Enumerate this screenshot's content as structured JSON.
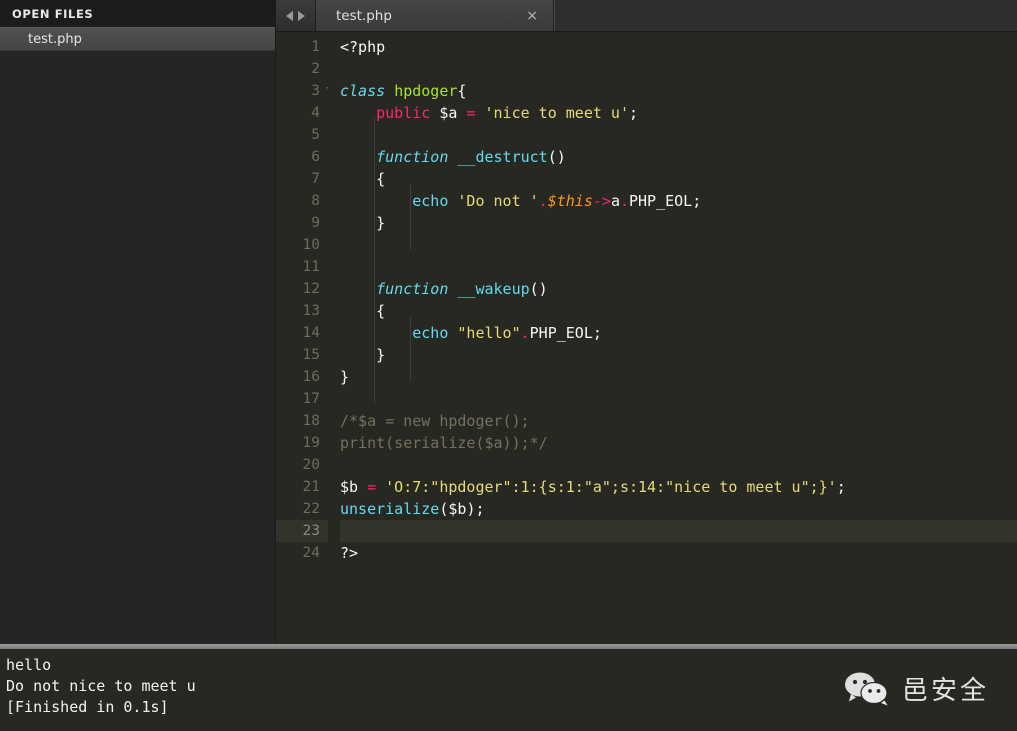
{
  "sidebar": {
    "header": "OPEN FILES",
    "files": [
      {
        "name": "test.php"
      }
    ]
  },
  "tabbar": {
    "nav_back_icon": "arrow-left-icon",
    "nav_forward_icon": "arrow-right-icon",
    "tabs": [
      {
        "label": "test.php",
        "close_label": "×",
        "active": true
      }
    ]
  },
  "editor": {
    "language": "PHP",
    "active_line": 23,
    "fold_marker_line": 3,
    "lines": [
      {
        "n": 1,
        "tokens": [
          {
            "t": "<?php",
            "c": "punc"
          }
        ]
      },
      {
        "n": 2,
        "tokens": []
      },
      {
        "n": 3,
        "tokens": [
          {
            "t": "class ",
            "c": "kw-storage"
          },
          {
            "t": "hpdoger",
            "c": "entity"
          },
          {
            "t": "{",
            "c": "punc"
          }
        ]
      },
      {
        "n": 4,
        "tokens": [
          {
            "t": "    ",
            "c": "punc"
          },
          {
            "t": "public",
            "c": "kw-mod"
          },
          {
            "t": " ",
            "c": "punc"
          },
          {
            "t": "$a",
            "c": "var"
          },
          {
            "t": " ",
            "c": "punc"
          },
          {
            "t": "=",
            "c": "op"
          },
          {
            "t": " ",
            "c": "punc"
          },
          {
            "t": "'nice to meet u'",
            "c": "string"
          },
          {
            "t": ";",
            "c": "punc"
          }
        ]
      },
      {
        "n": 5,
        "tokens": []
      },
      {
        "n": 6,
        "tokens": [
          {
            "t": "    ",
            "c": "punc"
          },
          {
            "t": "function ",
            "c": "kw-storage"
          },
          {
            "t": "__destruct",
            "c": "builtin"
          },
          {
            "t": "()",
            "c": "punc"
          }
        ]
      },
      {
        "n": 7,
        "tokens": [
          {
            "t": "    {",
            "c": "punc"
          }
        ]
      },
      {
        "n": 8,
        "tokens": [
          {
            "t": "        ",
            "c": "punc"
          },
          {
            "t": "echo",
            "c": "kw-echo"
          },
          {
            "t": " ",
            "c": "punc"
          },
          {
            "t": "'Do not '",
            "c": "string"
          },
          {
            "t": ".",
            "c": "op"
          },
          {
            "t": "$this",
            "c": "varthis"
          },
          {
            "t": "->",
            "c": "op"
          },
          {
            "t": "a",
            "c": "var"
          },
          {
            "t": ".",
            "c": "op"
          },
          {
            "t": "PHP_EOL",
            "c": "const"
          },
          {
            "t": ";",
            "c": "punc"
          }
        ]
      },
      {
        "n": 9,
        "tokens": [
          {
            "t": "    }",
            "c": "punc"
          }
        ]
      },
      {
        "n": 10,
        "tokens": []
      },
      {
        "n": 11,
        "tokens": []
      },
      {
        "n": 12,
        "tokens": [
          {
            "t": "    ",
            "c": "punc"
          },
          {
            "t": "function ",
            "c": "kw-storage"
          },
          {
            "t": "__wakeup",
            "c": "builtin"
          },
          {
            "t": "()",
            "c": "punc"
          }
        ]
      },
      {
        "n": 13,
        "tokens": [
          {
            "t": "    {",
            "c": "punc"
          }
        ]
      },
      {
        "n": 14,
        "tokens": [
          {
            "t": "        ",
            "c": "punc"
          },
          {
            "t": "echo",
            "c": "kw-echo"
          },
          {
            "t": " ",
            "c": "punc"
          },
          {
            "t": "\"hello\"",
            "c": "string"
          },
          {
            "t": ".",
            "c": "op"
          },
          {
            "t": "PHP_EOL",
            "c": "const"
          },
          {
            "t": ";",
            "c": "punc"
          }
        ]
      },
      {
        "n": 15,
        "tokens": [
          {
            "t": "    }",
            "c": "punc"
          }
        ]
      },
      {
        "n": 16,
        "tokens": [
          {
            "t": "}",
            "c": "punc"
          }
        ]
      },
      {
        "n": 17,
        "tokens": []
      },
      {
        "n": 18,
        "tokens": [
          {
            "t": "/*$a = new hpdoger();",
            "c": "comment"
          }
        ]
      },
      {
        "n": 19,
        "tokens": [
          {
            "t": "print(serialize($a));*/",
            "c": "comment"
          }
        ]
      },
      {
        "n": 20,
        "tokens": []
      },
      {
        "n": 21,
        "tokens": [
          {
            "t": "$b",
            "c": "var"
          },
          {
            "t": " ",
            "c": "punc"
          },
          {
            "t": "=",
            "c": "op"
          },
          {
            "t": " ",
            "c": "punc"
          },
          {
            "t": "'O:7:\"hpdoger\":1:{s:1:\"a\";s:14:\"nice to meet u\";}'",
            "c": "string"
          },
          {
            "t": ";",
            "c": "punc"
          }
        ]
      },
      {
        "n": 22,
        "tokens": [
          {
            "t": "unserialize",
            "c": "builtin"
          },
          {
            "t": "(",
            "c": "punc"
          },
          {
            "t": "$b",
            "c": "var"
          },
          {
            "t": ");",
            "c": "punc"
          }
        ]
      },
      {
        "n": 23,
        "tokens": []
      },
      {
        "n": 24,
        "tokens": [
          {
            "t": "?>",
            "c": "punc"
          }
        ]
      }
    ]
  },
  "console": {
    "lines": [
      "hello",
      "Do not nice to meet u",
      "[Finished in 0.1s]"
    ]
  },
  "watermark": {
    "icon": "wechat-icon",
    "text": "邑安全"
  },
  "colors": {
    "editor_bg": "#272822",
    "sidebar_bg": "#252526",
    "tab_active_bg": "#3f3f3f",
    "accent_pink": "#f92672",
    "accent_cyan": "#66d9ef",
    "accent_green": "#a6e22e",
    "accent_yellow": "#e6db74",
    "accent_orange": "#fd971f",
    "comment_gray": "#75715e",
    "splitter": "#8b8b8b"
  }
}
